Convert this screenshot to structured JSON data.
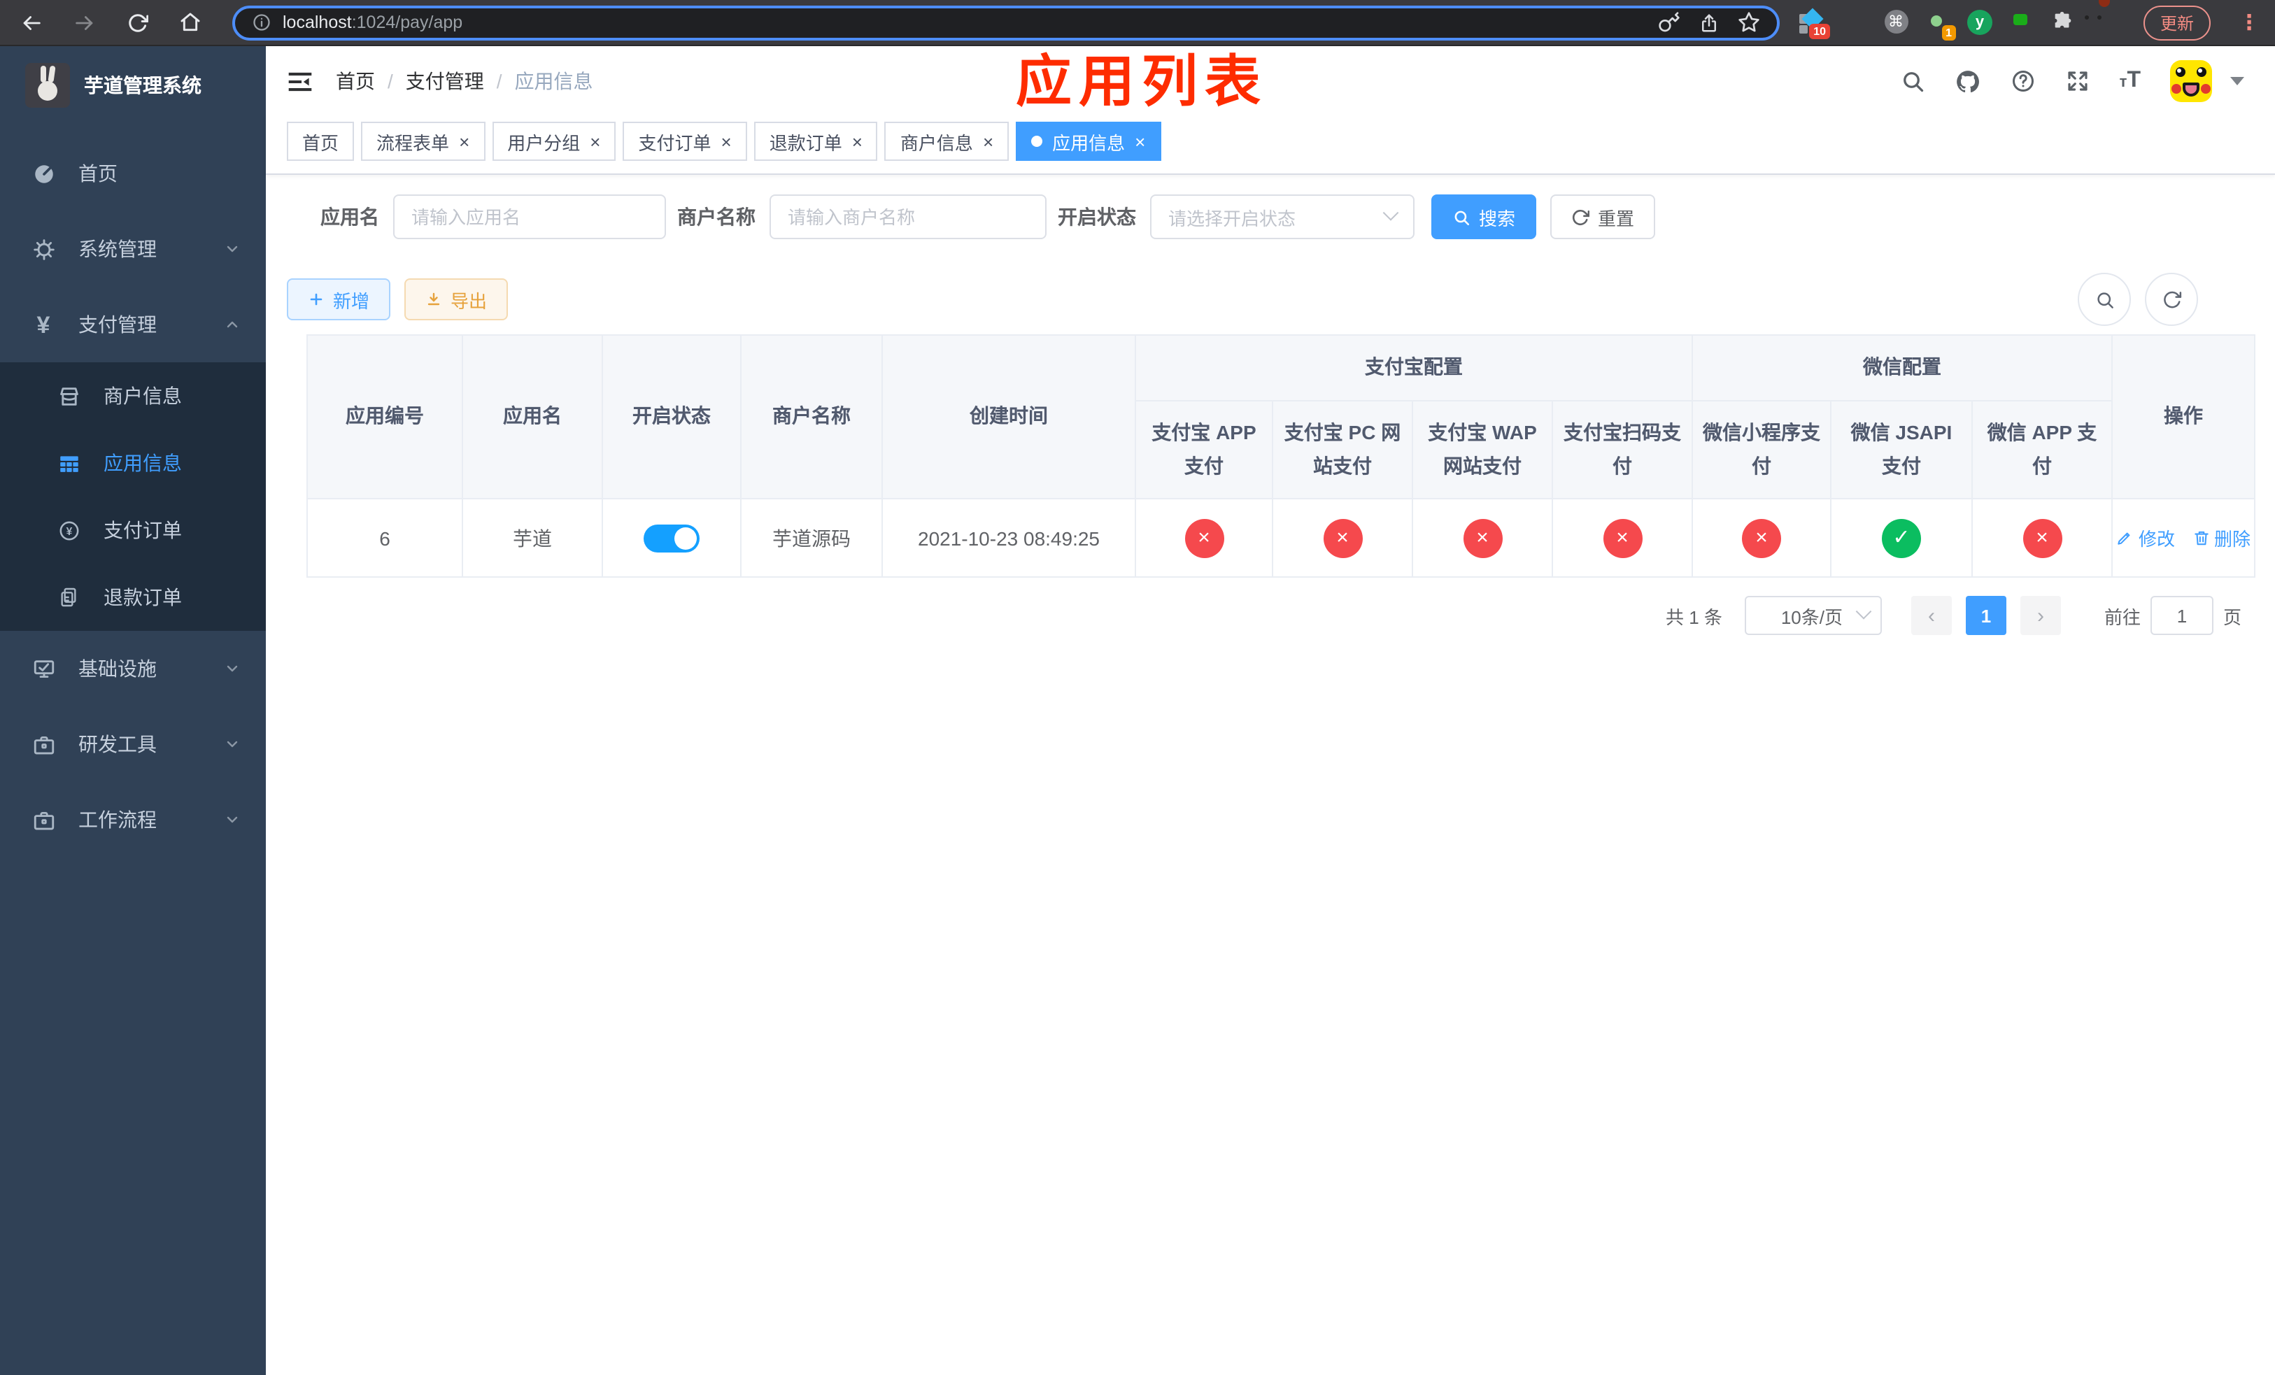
{
  "colors": {
    "accent": "#409eff",
    "toggle_on": "#14a0ff",
    "danger": "#f5494d",
    "success": "#0bbd60",
    "title_red": "#fe2c00",
    "sidebar_bg": "#304156",
    "submenu_bg": "#1f2d3d"
  },
  "browser": {
    "url_host": "localhost",
    "url_path": ":1024/pay/app",
    "update_label": "更新",
    "kebab_glyph": "⋮",
    "ext_badge_ten": "10",
    "ext_badge_one": "1",
    "ext_command_glyph": "⌘",
    "ext_y_glyph": "y"
  },
  "sidebar": {
    "logo_title": "芋道管理系统",
    "items": {
      "home": "首页",
      "system": "系统管理",
      "payment": "支付管理",
      "merchant": "商户信息",
      "app_info": "应用信息",
      "pay_order": "支付订单",
      "refund_order": "退款订单",
      "infra": "基础设施",
      "dev_tools": "研发工具",
      "workflow": "工作流程"
    }
  },
  "header": {
    "breadcrumb": {
      "home": "首页",
      "section": "支付管理",
      "current": "应用信息"
    },
    "overlay_title": "应用列表"
  },
  "tabs": [
    {
      "label": "首页",
      "closable": false,
      "active": false
    },
    {
      "label": "流程表单",
      "closable": true,
      "active": false
    },
    {
      "label": "用户分组",
      "closable": true,
      "active": false
    },
    {
      "label": "支付订单",
      "closable": true,
      "active": false
    },
    {
      "label": "退款订单",
      "closable": true,
      "active": false
    },
    {
      "label": "商户信息",
      "closable": true,
      "active": false
    },
    {
      "label": "应用信息",
      "closable": true,
      "active": true
    }
  ],
  "filters": {
    "app_name_label": "应用名",
    "app_name_placeholder": "请输入应用名",
    "merchant_label": "商户名称",
    "merchant_placeholder": "请输入商户名称",
    "status_label": "开启状态",
    "status_placeholder": "请选择开启状态",
    "search_label": "搜索",
    "reset_label": "重置"
  },
  "toolbar": {
    "add_label": "新增",
    "export_label": "导出"
  },
  "table": {
    "headers": {
      "app_id": "应用编号",
      "app_name": "应用名",
      "status": "开启状态",
      "merchant": "商户名称",
      "create_time": "创建时间",
      "alipay_group": "支付宝配置",
      "wechat_group": "微信配置",
      "alipay_app": "支付宝 APP 支付",
      "alipay_pc": "支付宝 PC 网站支付",
      "alipay_wap": "支付宝 WAP 网站支付",
      "alipay_qr": "支付宝扫码支付",
      "wx_lite": "微信小程序支付",
      "wx_jsapi": "微信 JSAPI 支付",
      "wx_app": "微信 APP 支付",
      "actions": "操作"
    },
    "row": {
      "app_id": "6",
      "app_name": "芋道",
      "status_on": true,
      "merchant": "芋道源码",
      "create_time": "2021-10-23 08:49:25",
      "channel_enabled": [
        false,
        false,
        false,
        false,
        false,
        true,
        false
      ],
      "edit_label": "修改",
      "delete_label": "删除"
    },
    "glyphs": {
      "check": "✓",
      "cross": "×"
    }
  },
  "pagination": {
    "total_text": "共 1 条",
    "page_size": "10条/页",
    "prev_glyph": "‹",
    "next_glyph": "›",
    "current_page": "1",
    "goto_label": "前往",
    "goto_value": "1",
    "page_suffix": "页"
  }
}
